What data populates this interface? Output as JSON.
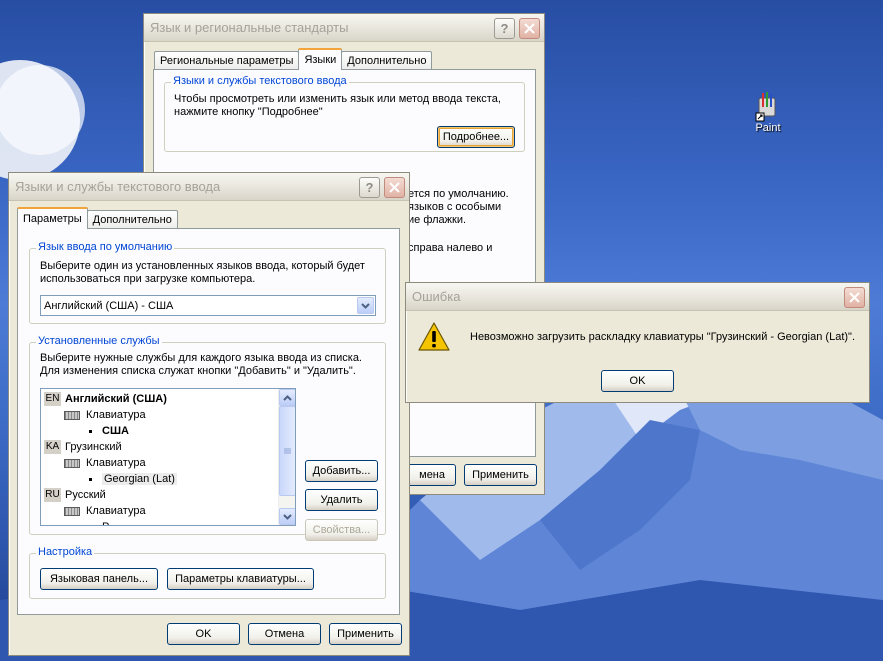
{
  "desktop": {
    "icon_label": "Paint"
  },
  "regional": {
    "title": "Язык и региональные стандарты",
    "tabs": [
      "Региональные параметры",
      "Языки",
      "Дополнительно"
    ],
    "group_title": "Языки и службы текстового ввода",
    "group_text_1": "Чтобы просмотреть или изменить язык или метод ввода текста,",
    "group_text_2": "нажмите кнопку \"Подробнее\"",
    "details_button": "Подробнее...",
    "partial_1": "ется по умолчанию.",
    "partial_2": "языков с особыми",
    "partial_3": "ие флажки.",
    "partial_4": "справа налево и",
    "cancel_partial": "мена",
    "apply_button": "Применить"
  },
  "services": {
    "title": "Языки и службы текстового ввода",
    "tabs": [
      "Параметры",
      "Дополнительно"
    ],
    "default_lang": {
      "legend": "Язык ввода по умолчанию",
      "text_1": "Выберите один из установленных языков ввода, который будет",
      "text_2": "использоваться при загрузке компьютера.",
      "selected": "Английский (США) - США"
    },
    "installed": {
      "legend": "Установленные службы",
      "text_1": "Выберите нужные службы для каждого языка ввода из списка.",
      "text_2": "Для изменения списка служат кнопки \"Добавить\" и \"Удалить\".",
      "items": [
        {
          "code": "EN",
          "lang": "Английский (США)",
          "kbd": "Клавиатура",
          "layout": "США"
        },
        {
          "code": "KA",
          "lang": "Грузинский",
          "kbd": "Клавиатура",
          "layout": "Georgian (Lat)"
        },
        {
          "code": "RU",
          "lang": "Русский",
          "kbd": "Клавиатура",
          "layout": "Р"
        }
      ],
      "add_button": "Добавить...",
      "remove_button": "Удалить",
      "props_button": "Свойства..."
    },
    "settings": {
      "legend": "Настройка",
      "langbar_button": "Языковая панель...",
      "keyboard_button": "Параметры клавиатуры..."
    },
    "ok_button": "OK",
    "cancel_button": "Отмена",
    "apply_button": "Применить"
  },
  "error": {
    "title": "Ошибка",
    "message": "Невозможно загрузить раскладку клавиатуры \"Грузинский - Georgian (Lat)\".",
    "ok_button": "OK"
  },
  "colors": {
    "accent_legend": "#0046d5",
    "tab_highlight": "#f2a33a",
    "warning": "#f5c400"
  }
}
